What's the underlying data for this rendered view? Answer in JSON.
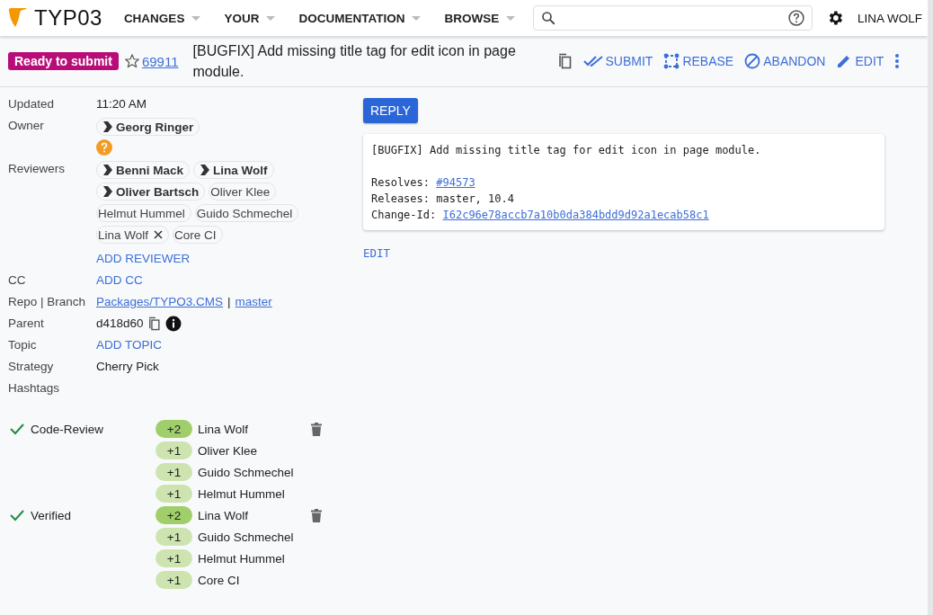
{
  "header": {
    "logo": "TYP03",
    "menus": [
      {
        "label": "CHANGES"
      },
      {
        "label": "YOUR"
      },
      {
        "label": "DOCUMENTATION"
      },
      {
        "label": "BROWSE"
      }
    ],
    "user": "LINA WOLF"
  },
  "change": {
    "status": "Ready to submit",
    "starred": false,
    "number": "69911",
    "subject": "[BUGFIX] Add missing title tag for edit icon in page module.",
    "actions": [
      "SUBMIT",
      "REBASE",
      "ABANDON",
      "EDIT"
    ]
  },
  "metadata": {
    "updated": {
      "label": "Updated",
      "value": "11:20 AM"
    },
    "owner": {
      "label": "Owner",
      "name": "Georg Ringer",
      "attention": true
    },
    "reviewers": {
      "label": "Reviewers",
      "people": [
        {
          "name": "Benni Mack",
          "attention": true,
          "removable": false
        },
        {
          "name": "Lina Wolf",
          "attention": true,
          "removable": false
        },
        {
          "name": "Oliver Bartsch",
          "attention": true,
          "removable": false
        },
        {
          "name": "Oliver Klee",
          "attention": false,
          "removable": false
        },
        {
          "name": "Helmut Hummel",
          "attention": false,
          "removable": false
        },
        {
          "name": "Guido Schmechel",
          "attention": false,
          "removable": false
        },
        {
          "name": "Lina Wolf",
          "attention": false,
          "removable": true
        },
        {
          "name": "Core CI",
          "attention": false,
          "removable": false
        }
      ],
      "add": "ADD REVIEWER"
    },
    "cc": {
      "label": "CC",
      "add": "ADD CC"
    },
    "repo_branch": {
      "label": "Repo | Branch",
      "repo": "Packages/TYPO3.CMS",
      "separator": "|",
      "branch": "master"
    },
    "parent": {
      "label": "Parent",
      "value": "d418d60"
    },
    "topic": {
      "label": "Topic",
      "add": "ADD TOPIC"
    },
    "strategy": {
      "label": "Strategy",
      "value": "Cherry Pick"
    },
    "hashtags": {
      "label": "Hashtags"
    }
  },
  "labels": [
    {
      "name": "Code-Review",
      "satisfied": true,
      "votes": [
        {
          "score": "+2",
          "max": true,
          "voter": "Lina Wolf",
          "deletable": true
        },
        {
          "score": "+1",
          "max": false,
          "voter": "Oliver Klee",
          "deletable": false
        },
        {
          "score": "+1",
          "max": false,
          "voter": "Guido Schmechel",
          "deletable": false
        },
        {
          "score": "+1",
          "max": false,
          "voter": "Helmut Hummel",
          "deletable": false
        }
      ]
    },
    {
      "name": "Verified",
      "satisfied": true,
      "votes": [
        {
          "score": "+2",
          "max": true,
          "voter": "Lina Wolf",
          "deletable": true
        },
        {
          "score": "+1",
          "max": false,
          "voter": "Guido Schmechel",
          "deletable": false
        },
        {
          "score": "+1",
          "max": false,
          "voter": "Helmut Hummel",
          "deletable": false
        },
        {
          "score": "+1",
          "max": false,
          "voter": "Core CI",
          "deletable": false
        }
      ]
    }
  ],
  "reply_button": "REPLY",
  "commit_message": {
    "title": "[BUGFIX] Add missing title tag for edit icon in page module.",
    "fields": [
      {
        "label": "Resolves:",
        "value": "#94573",
        "link": true
      },
      {
        "label": "Releases:",
        "value": "master, 10.4",
        "link": false
      },
      {
        "label": "Change-Id:",
        "value": "I62c96e78accb7a10b0da384bdd9d92a1ecab58c1",
        "link": true
      }
    ],
    "edit": "EDIT"
  }
}
